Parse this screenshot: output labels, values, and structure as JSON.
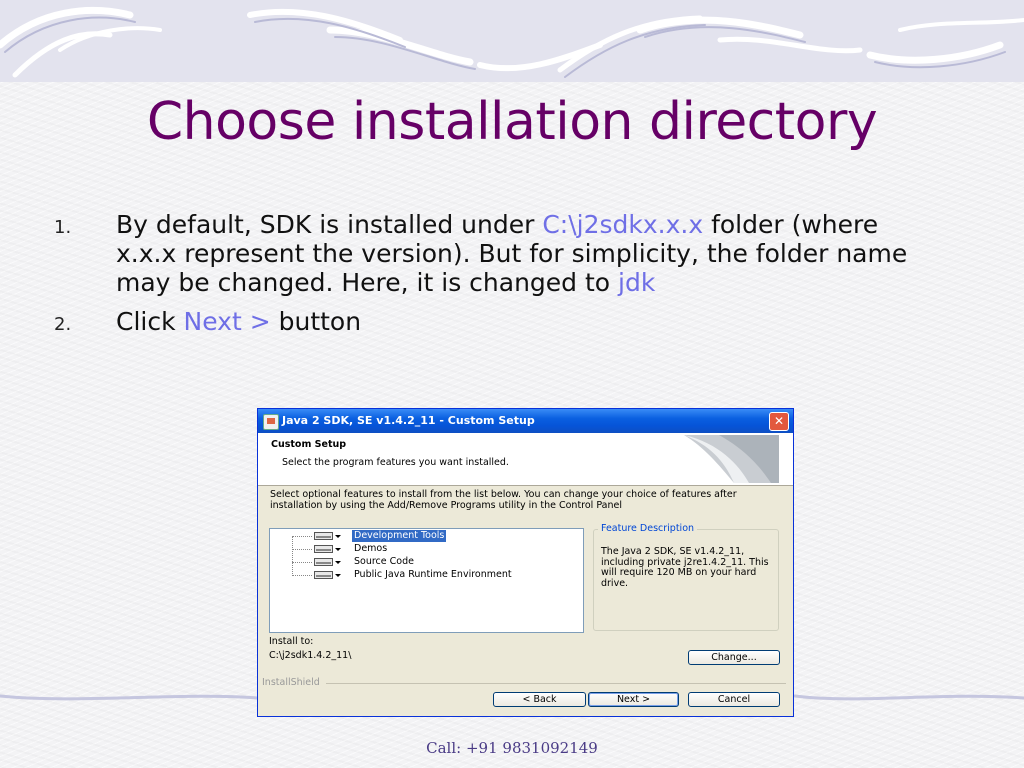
{
  "slide": {
    "title": "Choose installation directory",
    "bullets": [
      {
        "number": "1.",
        "segments": [
          {
            "text": "By default, SDK is installed under ",
            "highlight": false
          },
          {
            "text": "C:\\j2sdkx.x.x",
            "highlight": true
          },
          {
            "text": " folder (where x.x.x represent the version).  But for simplicity, the folder name may be changed.  Here, it is changed to ",
            "highlight": false
          },
          {
            "text": "jdk",
            "highlight": true
          }
        ]
      },
      {
        "number": "2.",
        "segments": [
          {
            "text": "Click ",
            "highlight": false
          },
          {
            "text": "Next >",
            "highlight": true
          },
          {
            "text": " button",
            "highlight": false
          }
        ]
      }
    ],
    "footer": "Call: +91 9831092149",
    "colors": {
      "title": "#660066",
      "highlight": "#6f6fe6",
      "footer": "#4a3b86"
    }
  },
  "dialog": {
    "window_title": "Java 2 SDK, SE v1.4.2_11 - Custom Setup",
    "close_icon": "close-x",
    "header_title": "Custom Setup",
    "header_subtitle": "Select the program features you want installed.",
    "instructions": "Select optional features to install from the list below.  You can change your choice of features after installation by using the Add/Remove Programs utility in the Control Panel",
    "features": [
      {
        "label": "Development Tools",
        "selected": true
      },
      {
        "label": "Demos",
        "selected": false
      },
      {
        "label": "Source Code",
        "selected": false
      },
      {
        "label": "Public Java Runtime Environment",
        "selected": false
      }
    ],
    "feature_description_legend": "Feature Description",
    "feature_description": "The Java 2 SDK, SE v1.4.2_11, including private j2re1.4.2_11. This will require 120 MB on your hard drive.",
    "install_to_label": "Install to:",
    "install_path": "C:\\j2sdk1.4.2_11\\",
    "change_button": "Change...",
    "installshield_label": "InstallShield",
    "back_button": "< Back",
    "next_button": "Next >",
    "cancel_button": "Cancel"
  }
}
